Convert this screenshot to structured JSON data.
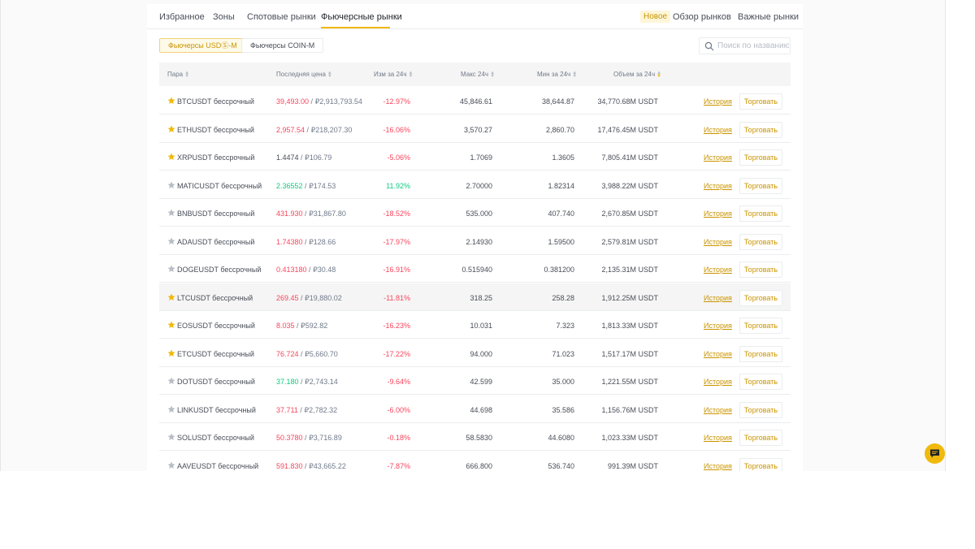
{
  "tabs": {
    "favorites": "Избранное",
    "zones": "Зоны",
    "spot": "Спотовые рынки",
    "futures": "Фьючерсные рынки",
    "new_badge": "Новое",
    "overview": "Обзор рынков",
    "important": "Важные рынки"
  },
  "filters": {
    "usdm": "Фьючерсы USDⓈ-M",
    "coinm": "Фьючерсы COIN-M"
  },
  "search": {
    "placeholder": "Поиск по названию"
  },
  "table": {
    "columns": {
      "pair": "Пара",
      "last_price": "Последняя цена",
      "change": "Изм за 24ч",
      "high": "Макс 24ч",
      "low": "Мин за 24ч",
      "volume": "Объем за 24ч"
    },
    "history_label": "История",
    "trade_label": "Торговать",
    "rows": [
      {
        "pair": "BTCUSDT бессрочный",
        "fav": true,
        "price": "39,493.00",
        "rub": "₽2,913,793.54",
        "dir": "down",
        "change": "-12.97%",
        "high": "45,846.61",
        "low": "38,644.87",
        "volume": "34,770.68M USDT"
      },
      {
        "pair": "ETHUSDT бессрочный",
        "fav": true,
        "price": "2,957.54",
        "rub": "₽218,207.30",
        "dir": "down",
        "change": "-16.06%",
        "high": "3,570.27",
        "low": "2,860.70",
        "volume": "17,476.45M USDT"
      },
      {
        "pair": "XRPUSDT бессрочный",
        "fav": true,
        "price": "1.4474",
        "rub": "₽106.79",
        "dir": "neutral",
        "change": "-5.06%",
        "high": "1.7069",
        "low": "1.3605",
        "volume": "7,805.41M USDT"
      },
      {
        "pair": "MATICUSDT бессрочный",
        "fav": false,
        "price": "2.36552",
        "rub": "₽174.53",
        "dir": "up",
        "change": "11.92%",
        "high": "2.70000",
        "low": "1.82314",
        "volume": "3,988.22M USDT"
      },
      {
        "pair": "BNBUSDT бессрочный",
        "fav": false,
        "price": "431.930",
        "rub": "₽31,867.80",
        "dir": "down",
        "change": "-18.52%",
        "high": "535.000",
        "low": "407.740",
        "volume": "2,670.85M USDT"
      },
      {
        "pair": "ADAUSDT бессрочный",
        "fav": false,
        "price": "1.74380",
        "rub": "₽128.66",
        "dir": "down",
        "change": "-17.97%",
        "high": "2.14930",
        "low": "1.59500",
        "volume": "2,579.81M USDT"
      },
      {
        "pair": "DOGEUSDT бессрочный",
        "fav": false,
        "price": "0.413180",
        "rub": "₽30.48",
        "dir": "down",
        "change": "-16.91%",
        "high": "0.515940",
        "low": "0.381200",
        "volume": "2,135.31M USDT"
      },
      {
        "pair": "LTCUSDT бессрочный",
        "fav": true,
        "price": "269.45",
        "rub": "₽19,880.02",
        "dir": "down",
        "change": "-11.81%",
        "high": "318.25",
        "low": "258.28",
        "volume": "1,912.25M USDT"
      },
      {
        "pair": "EOSUSDT бессрочный",
        "fav": true,
        "price": "8.035",
        "rub": "₽592.82",
        "dir": "down",
        "change": "-16.23%",
        "high": "10.031",
        "low": "7.323",
        "volume": "1,813.33M USDT"
      },
      {
        "pair": "ETCUSDT бессрочный",
        "fav": true,
        "price": "76.724",
        "rub": "₽5,660.70",
        "dir": "down",
        "change": "-17.22%",
        "high": "94.000",
        "low": "71.023",
        "volume": "1,517.17M USDT"
      },
      {
        "pair": "DOTUSDT бессрочный",
        "fav": false,
        "price": "37.180",
        "rub": "₽2,743.14",
        "dir": "up",
        "change": "-9.64%",
        "high": "42.599",
        "low": "35.000",
        "volume": "1,221.55M USDT"
      },
      {
        "pair": "LINKUSDT бессрочный",
        "fav": false,
        "price": "37.711",
        "rub": "₽2,782.32",
        "dir": "down",
        "change": "-6.00%",
        "high": "44.698",
        "low": "35.586",
        "volume": "1,156.76M USDT"
      },
      {
        "pair": "SOLUSDT бессрочный",
        "fav": false,
        "price": "50.3780",
        "rub": "₽3,716.89",
        "dir": "down",
        "change": "-0.18%",
        "high": "58.5830",
        "low": "44.6080",
        "volume": "1,023.33M USDT"
      },
      {
        "pair": "AAVEUSDT бессрочный",
        "fav": false,
        "price": "591.830",
        "rub": "₽43,665.22",
        "dir": "down",
        "change": "-7.87%",
        "high": "666.800",
        "low": "536.740",
        "volume": "991.39M USDT"
      }
    ]
  },
  "colors": {
    "accent": "#f0b90b",
    "up": "#0ecb81",
    "down": "#f6465d",
    "star_on": "#f0b90b",
    "star_off": "#b7bdc6"
  },
  "icons": {
    "favorite": "star-icon",
    "search": "search-icon",
    "sort": "sort-icon",
    "chat": "chat-icon"
  }
}
